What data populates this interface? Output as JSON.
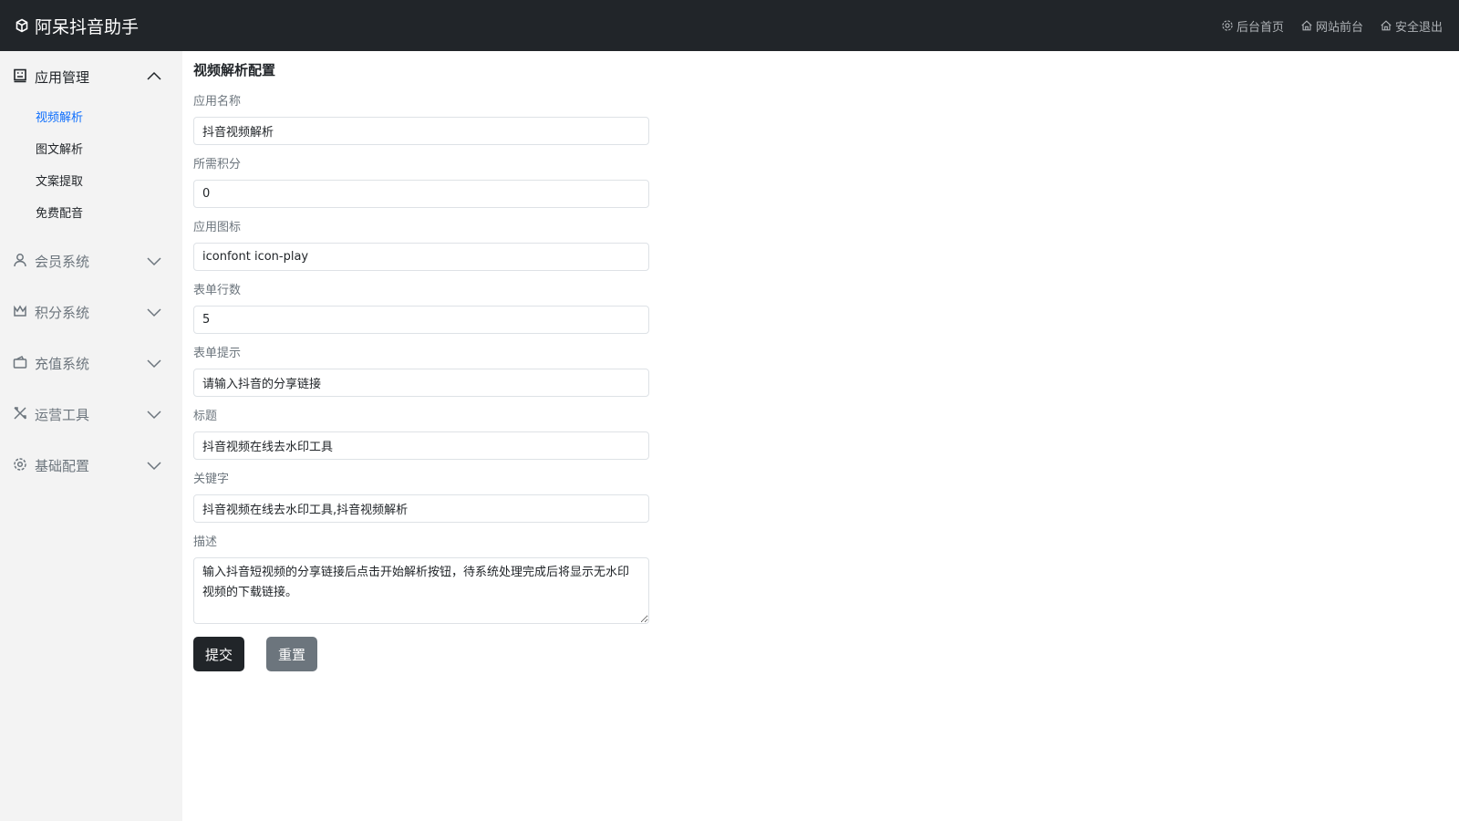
{
  "header": {
    "brand": "阿呆抖音助手",
    "nav": [
      {
        "label": "后台首页",
        "icon": "gear-icon"
      },
      {
        "label": "网站前台",
        "icon": "home-icon"
      },
      {
        "label": "安全退出",
        "icon": "home-icon"
      }
    ]
  },
  "sidebar": {
    "app_group": {
      "label": "应用管理",
      "items": [
        "视频解析",
        "图文解析",
        "文案提取",
        "免费配音"
      ],
      "active": "视频解析"
    },
    "groups": [
      {
        "label": "会员系统"
      },
      {
        "label": "积分系统"
      },
      {
        "label": "充值系统"
      },
      {
        "label": "运营工具"
      },
      {
        "label": "基础配置"
      }
    ]
  },
  "form": {
    "title": "视频解析配置",
    "fields": [
      {
        "label": "应用名称",
        "value": "抖音视频解析"
      },
      {
        "label": "所需积分",
        "value": "0"
      },
      {
        "label": "应用图标",
        "value": "iconfont icon-play"
      },
      {
        "label": "表单行数",
        "value": "5"
      },
      {
        "label": "表单提示",
        "value": "请输入抖音的分享链接"
      },
      {
        "label": "标题",
        "value": "抖音视频在线去水印工具"
      },
      {
        "label": "关键字",
        "value": "抖音视频在线去水印工具,抖音视频解析"
      }
    ],
    "description": {
      "label": "描述",
      "value": "输入抖音短视频的分享链接后点击开始解析按钮，待系统处理完成后将显示无水印视频的下载链接。"
    },
    "submit": "提交",
    "reset": "重置"
  }
}
